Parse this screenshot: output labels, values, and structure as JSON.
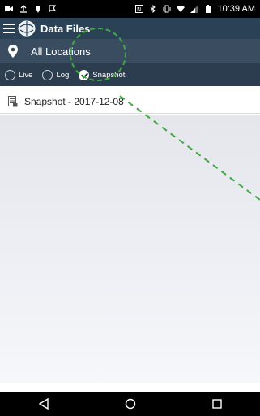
{
  "status_bar": {
    "time": "10:39 AM"
  },
  "app_bar": {
    "title": "Data Files"
  },
  "location": {
    "label": "All Locations"
  },
  "filters": [
    {
      "label": "Live",
      "checked": false
    },
    {
      "label": "Log",
      "checked": false
    },
    {
      "label": "Snapshot",
      "checked": true
    }
  ],
  "files": [
    {
      "label": "Snapshot - 2017-12-08"
    }
  ],
  "annotation": {
    "color": "#3caa3c"
  }
}
